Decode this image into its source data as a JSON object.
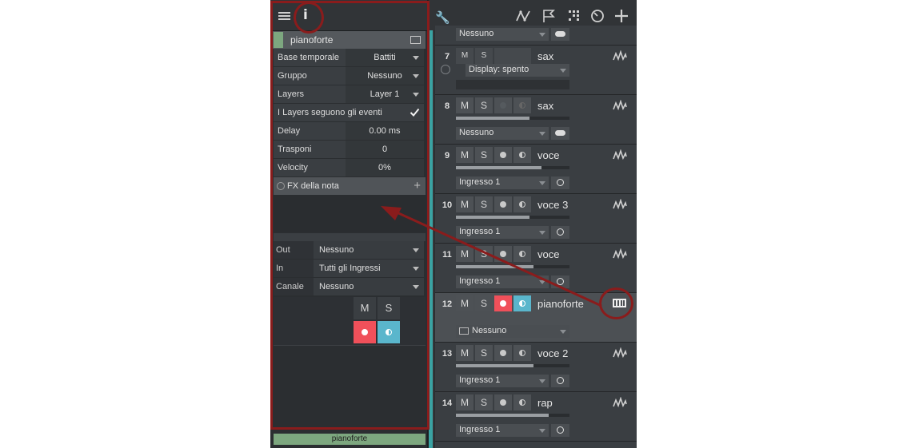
{
  "inspector": {
    "track_name": "pianoforte",
    "rows": [
      {
        "label": "Base temporale",
        "value": "Battiti"
      },
      {
        "label": "Gruppo",
        "value": "Nessuno"
      },
      {
        "label": "Layers",
        "value": "Layer 1"
      }
    ],
    "layers_follow_label": "I Layers seguono gli eventi",
    "layers_follow_checked": true,
    "delay_label": "Delay",
    "delay_value": "0.00 ms",
    "transpose_label": "Trasponi",
    "transpose_value": "0",
    "velocity_label": "Velocity",
    "velocity_value": "0%",
    "fx_label": "FX della nota",
    "io": [
      {
        "label": "Out",
        "value": "Nessuno"
      },
      {
        "label": "In",
        "value": "Tutti gli Ingressi"
      },
      {
        "label": "Canale",
        "value": "Nessuno"
      }
    ],
    "mute": "M",
    "solo": "S",
    "bottom_name": "pianoforte"
  },
  "toolbar": {
    "icons": [
      "wrench-icon",
      "automation-icon",
      "flag-icon",
      "grid-icon",
      "clock-icon",
      "plus-icon"
    ]
  },
  "tracks": {
    "top_partial": {
      "input": "Nessuno"
    },
    "t7": {
      "num": "7",
      "name": "sax",
      "m": "M",
      "s": "S",
      "display": "Display: spento"
    },
    "t8": {
      "num": "8",
      "name": "sax",
      "m": "M",
      "s": "S",
      "input": "Nessuno",
      "level": 0.65
    },
    "t9": {
      "num": "9",
      "name": "voce",
      "m": "M",
      "s": "S",
      "input": "Ingresso 1",
      "level": 0.75
    },
    "t10": {
      "num": "10",
      "name": "voce 3",
      "m": "M",
      "s": "S",
      "input": "Ingresso 1",
      "level": 0.65
    },
    "t11": {
      "num": "11",
      "name": "voce",
      "m": "M",
      "s": "S",
      "input": "Ingresso 1",
      "level": 0.68
    },
    "t12": {
      "num": "12",
      "name": "pianoforte",
      "m": "M",
      "s": "S",
      "input": "Nessuno"
    },
    "t13": {
      "num": "13",
      "name": "voce 2",
      "m": "M",
      "s": "S",
      "input": "Ingresso 1",
      "level": 0.68
    },
    "t14": {
      "num": "14",
      "name": "rap",
      "m": "M",
      "s": "S",
      "input": "Ingresso 1",
      "level": 0.82
    }
  },
  "colors": {
    "annotation": "#8a1c1c",
    "record": "#f0505a",
    "monitor": "#5ab6cc",
    "track_color": "#7da77f"
  }
}
